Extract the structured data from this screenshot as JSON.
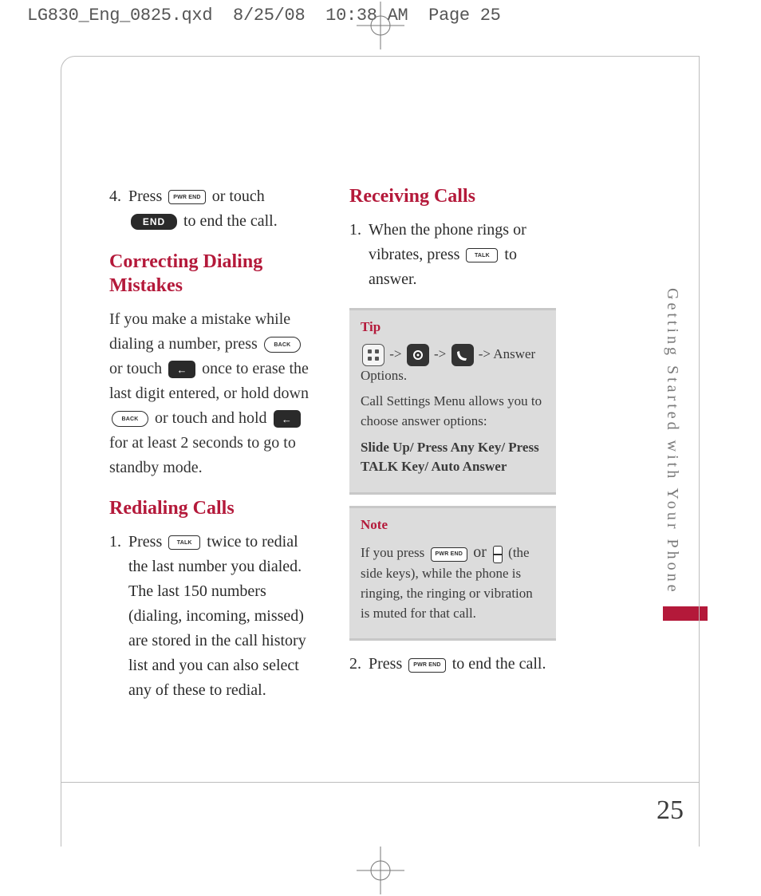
{
  "slug": "LG830_Eng_0825.qxd  8/25/08  10:38 AM  Page 25",
  "page_number": "25",
  "side_tab": "Getting Started with Your Phone",
  "icons": {
    "pwr_end": "PWR\nEND",
    "end_dark": "END",
    "back_pill": "BACK",
    "talk": "TALK",
    "arrow_left": "←"
  },
  "left": {
    "step4": {
      "n": "4.",
      "pre": "Press ",
      "mid": " or touch ",
      "post": " to end the call."
    },
    "h_correct": "Correcting Dialing Mistakes",
    "p_correct_1": "If you make a mistake while dialing a number, press ",
    "p_correct_2": " or touch ",
    "p_correct_3": " once to erase the last digit entered, or hold down ",
    "p_correct_4": " or touch and hold ",
    "p_correct_5": " for at least 2 seconds to go to standby mode.",
    "h_redial": "Redialing Calls",
    "redial_step": {
      "n": "1.",
      "pre": "Press ",
      "post": " twice to redial the last number you dialed. The last 150 numbers (dialing, incoming, missed) are stored in the call history list and you can also select any of these to redial."
    }
  },
  "right": {
    "h_receive": "Receiving Calls",
    "recv_step": {
      "n": "1.",
      "pre": "When the phone rings or vibrates, press ",
      "post": " to answer."
    },
    "tip": {
      "label": "Tip",
      "arrow": "->",
      "trail": " -> Answer Options.",
      "p1": "Call Settings Menu allows you to choose answer options:",
      "p2": "Slide Up/ Press Any Key/ Press TALK Key/ Auto Answer"
    },
    "note": {
      "label": "Note",
      "pre": "If you press ",
      "or": " or ",
      "post": " (the side keys), while the phone is ringing, the ringing or vibration is muted for that call."
    },
    "step2": {
      "n": "2.",
      "pre": "Press ",
      "post": " to end the call."
    }
  }
}
